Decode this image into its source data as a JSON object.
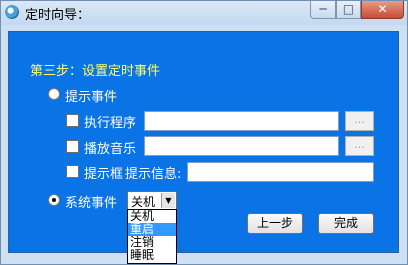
{
  "window": {
    "title": "定时向导：",
    "minimize_label": "─",
    "maximize_label": "□",
    "close_label": "✕"
  },
  "wizard": {
    "heading": "第三步：设置定时事件",
    "reminder_event_label": "提示事件",
    "run_program_label": "执行程序",
    "play_music_label": "播放音乐",
    "message_box_label": "提示框",
    "message_label": "提示信息:",
    "browse_label": "...",
    "system_event_label": "系统事件",
    "system_event_selected": "关机",
    "system_event_options": [
      "关机",
      "重启",
      "注销",
      "睡眠"
    ],
    "highlighted_option": "重启",
    "back_button": "上一步",
    "finish_button": "完成"
  }
}
